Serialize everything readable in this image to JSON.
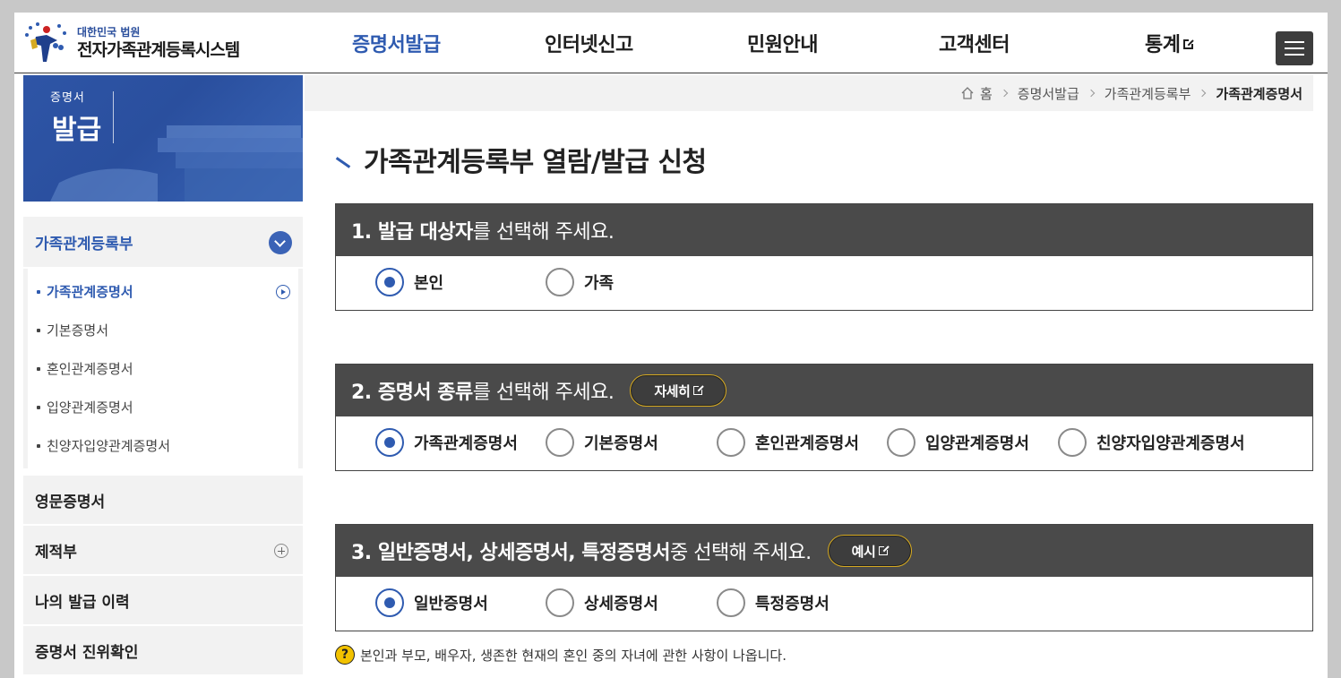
{
  "header": {
    "logo_small": "대한민국 법원",
    "logo_main": "전자가족관계등록시스템",
    "nav": [
      {
        "label": "증명서발급"
      },
      {
        "label": "인터넷신고"
      },
      {
        "label": "민원안내"
      },
      {
        "label": "고객센터"
      },
      {
        "label": "통계"
      }
    ]
  },
  "banner": {
    "line1": "증명서",
    "line2": "발급"
  },
  "sidebar": {
    "top_label": "가족관계등록부",
    "sub_items": [
      {
        "label": "가족관계증명서"
      },
      {
        "label": "기본증명서"
      },
      {
        "label": "혼인관계증명서"
      },
      {
        "label": "입양관계증명서"
      },
      {
        "label": "친양자입양관계증명서"
      }
    ],
    "items": [
      {
        "label": "영문증명서"
      },
      {
        "label": "제적부"
      },
      {
        "label": "나의 발급 이력"
      },
      {
        "label": "증명서 진위확인"
      }
    ]
  },
  "breadcrumb": {
    "home": "홈",
    "items": [
      "증명서발급",
      "가족관계등록부",
      "가족관계증명서"
    ]
  },
  "page_title": "가족관계등록부 열람/발급 신청",
  "sections": {
    "s1": {
      "bold": "1. 발급 대상자",
      "rest": "를 선택해 주세요.",
      "options": [
        "본인",
        "가족"
      ]
    },
    "s2": {
      "bold": "2. 증명서 종류",
      "rest": "를 선택해 주세요.",
      "button": "자세히",
      "options": [
        "가족관계증명서",
        "기본증명서",
        "혼인관계증명서",
        "입양관계증명서",
        "친양자입양관계증명서"
      ]
    },
    "s3": {
      "bold": "3. 일반증명서, 상세증명서, 특정증명서",
      "rest": " 중 선택해 주세요.",
      "button": "예시",
      "options": [
        "일반증명서",
        "상세증명서",
        "특정증명서"
      ]
    }
  },
  "note": {
    "icon": "?",
    "text": "본인과 부모, 배우자, 생존한 현재의 혼인 중의 자녀에 관한 사항이 나옵니다."
  },
  "colors": {
    "accent": "#2f5bb0",
    "section_header": "#4a4a4a",
    "pill_border": "#d6aa22"
  }
}
